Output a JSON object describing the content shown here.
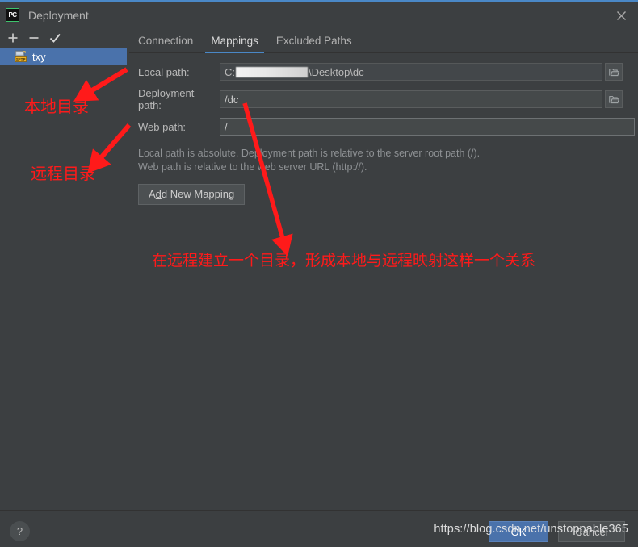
{
  "window": {
    "title": "Deployment",
    "logo_text": "PC",
    "close_icon": "close-icon"
  },
  "sidebar": {
    "toolbar": [
      {
        "name": "add-button",
        "icon": "plus-icon",
        "label": "+"
      },
      {
        "name": "remove-button",
        "icon": "minus-icon",
        "label": "−"
      },
      {
        "name": "set-default-button",
        "icon": "check-icon",
        "label": "✓"
      }
    ],
    "items": [
      {
        "label": "txy",
        "icon": "sftp-server-icon",
        "badge": "SFTP",
        "selected": true
      }
    ]
  },
  "tabs": [
    {
      "label": "Connection",
      "active": false
    },
    {
      "label": "Mappings",
      "active": true
    },
    {
      "label": "Excluded Paths",
      "active": false
    }
  ],
  "form": {
    "local_path": {
      "label_prefix": "",
      "label_mnemonic": "L",
      "label_rest": "ocal path:",
      "value_prefix": "C:",
      "value_suffix": "\\Desktop\\dc",
      "redacted": true,
      "browse_icon": "folder-icon"
    },
    "deployment_path": {
      "label_prefix": "D",
      "label_mnemonic": "e",
      "label_rest": "ployment path:",
      "value": "/dc",
      "browse_icon": "folder-icon"
    },
    "web_path": {
      "label_prefix": "",
      "label_mnemonic": "W",
      "label_rest": "eb path:",
      "value": "/"
    },
    "hint_line1": "Local path is absolute. Deployment path is relative to the server root path (/).",
    "hint_line2": "Web path is relative to the web server URL (http://).",
    "add_mapping": {
      "prefix": "A",
      "mnemonic": "d",
      "rest": "d New Mapping"
    }
  },
  "footer": {
    "help_label": "?",
    "ok_label": "OK",
    "cancel_label": "Cancel"
  },
  "annotations": {
    "local_dir": "本地目录",
    "remote_dir": "远程目录",
    "mapping_note": "在远程建立一个目录，形成本地与远程映射这样一个关系"
  },
  "watermark": "https://blog.csdn.net/unstoppable365",
  "colors": {
    "window_bg": "#3c3f41",
    "accent_blue": "#4a88c7",
    "selection_blue": "#4a72ab",
    "annotation_red": "#ff1a1a",
    "field_bg": "#45494a",
    "logo_green": "#3ec46d"
  }
}
